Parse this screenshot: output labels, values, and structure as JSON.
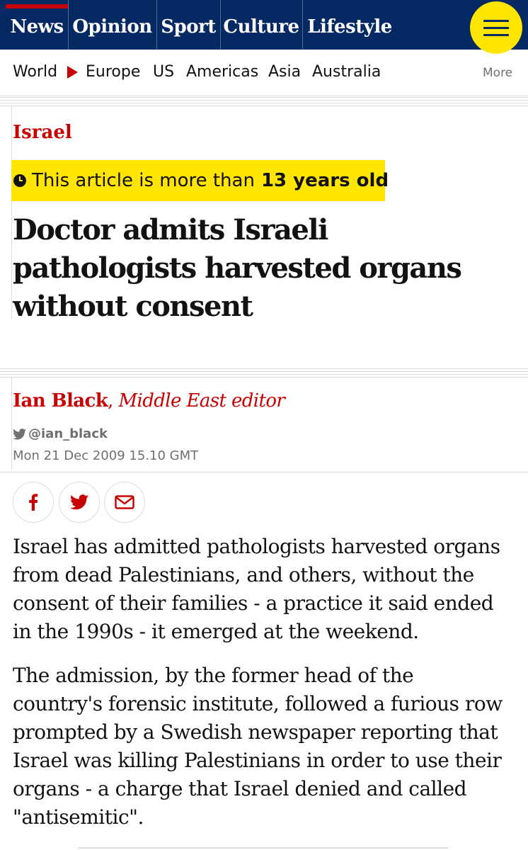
{
  "nav": {
    "pillars": [
      "News",
      "Opinion",
      "Sport",
      "Culture",
      "Lifestyle"
    ],
    "menu_icon": "hamburger-menu-icon",
    "brand_color": "#052962",
    "menu_color": "#ffe500"
  },
  "subnav": {
    "items": [
      "World",
      "Europe",
      "US",
      "Americas",
      "Asia",
      "Australia"
    ],
    "more": "More",
    "arrow_icon": "triangle-right-icon"
  },
  "article": {
    "section": "Israel",
    "age_badge": {
      "prefix": "This article is more than",
      "bold": "13 years old",
      "icon": "clock-icon"
    },
    "headline_lines": [
      "Doctor admits Israeli",
      "pathologists harvested organs",
      "without consent"
    ],
    "byline": {
      "name": "Ian Black",
      "role": "Middle East editor"
    },
    "twitter": "@ian_black",
    "date": "Mon 21 Dec 2009 15.10 GMT",
    "share_icons": [
      "facebook-icon",
      "twitter-icon",
      "email-icon"
    ],
    "paragraphs": [
      [
        "Israel has admitted pathologists harvested organs",
        "from dead Palestinians, and others, without the",
        "consent of their families - a practice it said ended",
        "in the 1990s - it emerged at the weekend."
      ],
      [
        "The admission, by the former head of the",
        "country's forensic institute, followed a furious row",
        "prompted by a Swedish newspaper reporting that",
        "Israel was killing Palestinians in order to use their",
        "organs - a charge that Israel denied and called",
        "\"antisemitic\"."
      ]
    ],
    "accent_color": "#c70000"
  }
}
